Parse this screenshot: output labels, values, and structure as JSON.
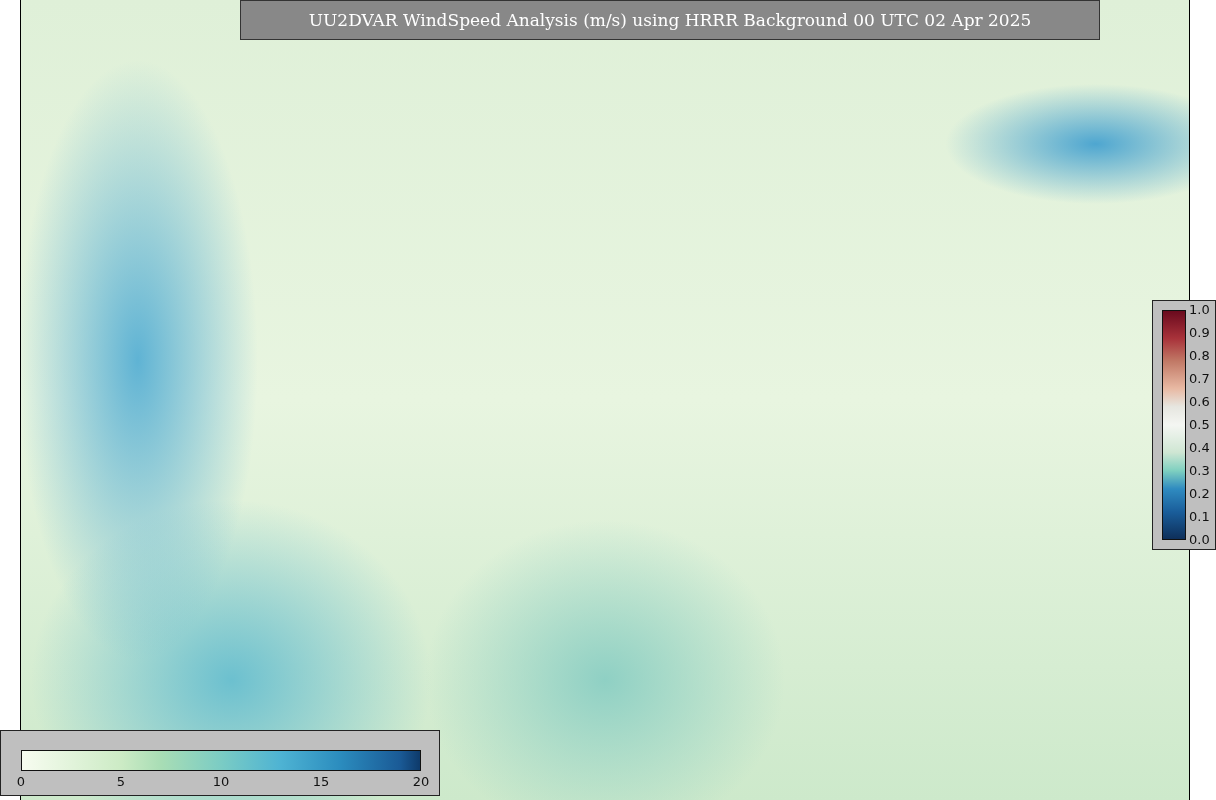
{
  "title": "UU2DVAR WindSpeed Analysis (m/s) using HRRR Background 00 UTC 02 Apr 2025",
  "side_colorbar": {
    "ticks": [
      "1.0",
      "0.9",
      "0.8",
      "0.7",
      "0.6",
      "0.5",
      "0.4",
      "0.3",
      "0.2",
      "0.1",
      "0.0"
    ]
  },
  "bottom_colorbar": {
    "ticks": [
      "0",
      "5",
      "10",
      "15",
      "20"
    ]
  }
}
